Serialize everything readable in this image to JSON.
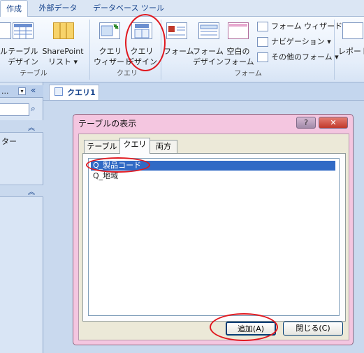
{
  "ribbon_tabs": [
    "作成",
    "外部データ",
    "データベース ツール"
  ],
  "ribbon": {
    "table_partial": "ル",
    "table_design": [
      "テーブル",
      "デザイン"
    ],
    "sharepoint_list": [
      "SharePoint",
      "リスト ▾"
    ],
    "group_table": "テーブル",
    "query_wizard": [
      "クエリ",
      "ウィザード"
    ],
    "query_design": [
      "クエリ",
      "デザイン"
    ],
    "group_query": "クエリ",
    "form": "フォーム",
    "form_design": [
      "フォーム",
      "デザイン"
    ],
    "blank_form": [
      "空白の",
      "フォーム"
    ],
    "form_wizard": "フォーム ウィザード",
    "navigation": "ナビゲーション ▾",
    "other_forms": "その他のフォーム ▾",
    "group_form": "フォーム",
    "report_partial": "レポート"
  },
  "nav": {
    "header_partial": "...",
    "item_partial": "ター"
  },
  "document_tab": "クエリ1",
  "dialog": {
    "title": "テーブルの表示",
    "help_button": "?",
    "close_button": "✕",
    "tabs": [
      "テーブル",
      "クエリ",
      "両方"
    ],
    "active_tab": "クエリ",
    "list_items": [
      "Q_製品コード",
      "Q_地域"
    ],
    "selected_item": "Q_製品コード",
    "add_button": "追加(A)",
    "close_dialog_button": "閉じる(C)"
  }
}
